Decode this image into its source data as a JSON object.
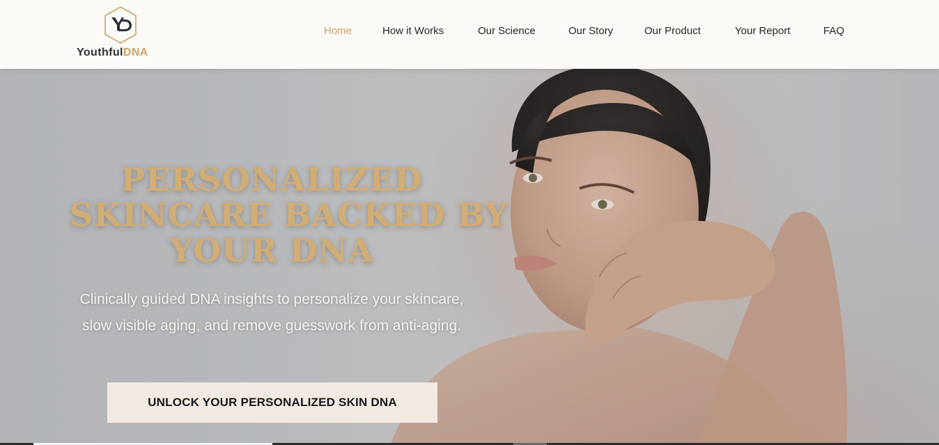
{
  "brand": {
    "name_part1": "Youthful",
    "name_part2": "DNA",
    "monogram": "YD"
  },
  "nav": {
    "items": [
      {
        "label": "Home",
        "active": true
      },
      {
        "label": "How it Works",
        "active": false
      },
      {
        "label": "Our Science",
        "active": false
      },
      {
        "label": "Our Story",
        "active": false
      },
      {
        "label": "Our Product",
        "active": false
      },
      {
        "label": "Your Report",
        "active": false
      },
      {
        "label": "FAQ",
        "active": false
      }
    ]
  },
  "hero": {
    "headline_lines": [
      "PERSONALIZED",
      "SKINCARE BACKED BY",
      "YOUR DNA"
    ],
    "subtext": "Clinically guided DNA insights to personalize your skincare, slow visible aging, and remove guesswork from anti-aging.",
    "cta_label": "UNLOCK YOUR PERSONALIZED SKIN DNA"
  },
  "colors": {
    "accent_gold": "#c9a263",
    "header_bg": "#fbfaf7",
    "text_dark": "#1f2229",
    "cta_bg": "#f1eae3"
  },
  "icons": {
    "logo": "hexagon-yd-monogram"
  }
}
